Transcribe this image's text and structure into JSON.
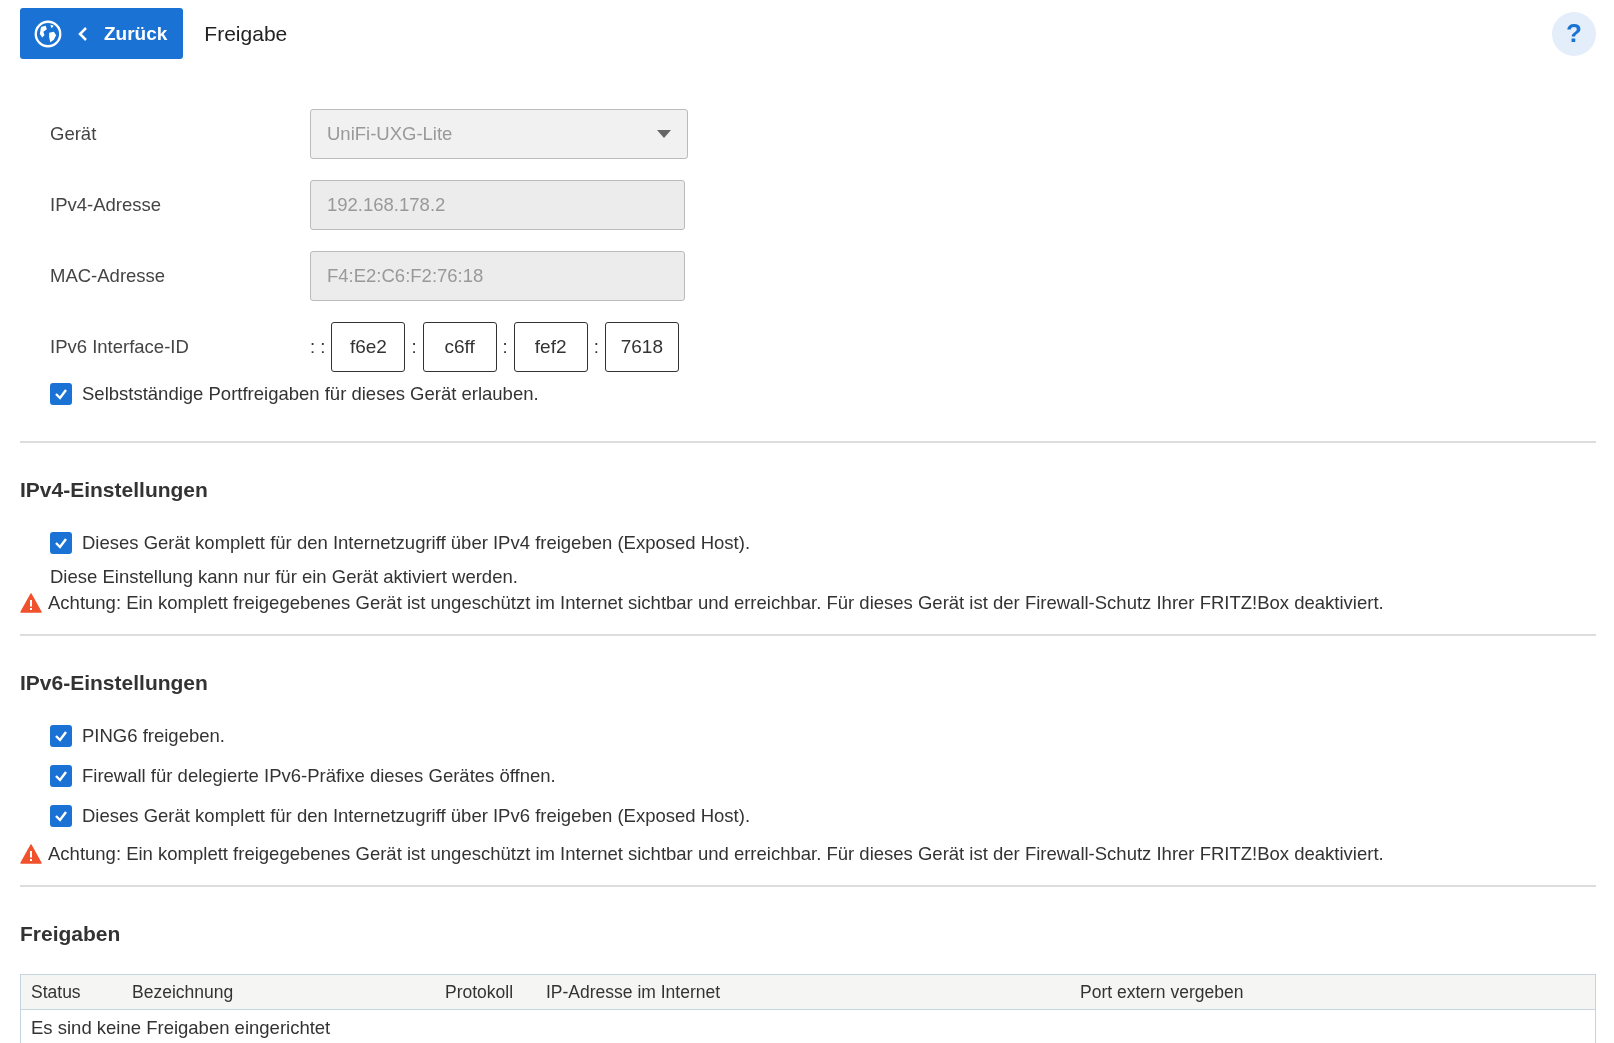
{
  "header": {
    "back_button": "Zurück",
    "title": "Freigabe",
    "help": "?"
  },
  "form": {
    "fields": [
      {
        "kind": "dropdown",
        "label": "Gerät",
        "value": "UniFi-UXG-Lite",
        "disabled": true
      },
      {
        "kind": "text",
        "label": "IPv4-Adresse",
        "value": "192.168.178.2",
        "disabled": true
      },
      {
        "kind": "text",
        "label": "MAC-Adresse",
        "value": "F4:E2:C6:F2:76:18",
        "disabled": true
      }
    ],
    "ipv6_interface_id": {
      "label": "IPv6 Interface-ID",
      "prefix": ": :",
      "separator": ":",
      "parts": [
        "f6e2",
        "c6ff",
        "fef2",
        "7618"
      ]
    },
    "checkbox": {
      "label": "Selbstständige Portfreigaben für dieses Gerät erlauben.",
      "checked": true
    }
  },
  "sections": [
    {
      "title": "IPv4-Einstellungen",
      "items": [
        {
          "kind": "checkbox",
          "text": "Dieses Gerät komplett für den Internetzugriff über IPv4 freigeben (Exposed Host).",
          "checked": true
        },
        {
          "kind": "note",
          "text": "Diese Einstellung kann nur für ein Gerät aktiviert werden."
        },
        {
          "kind": "warning",
          "text": "Achtung: Ein komplett freigegebenes Gerät ist ungeschützt im Internet sichtbar und erreichbar. Für dieses Gerät ist der Firewall-Schutz Ihrer FRITZ!Box deaktiviert."
        }
      ]
    },
    {
      "title": "IPv6-Einstellungen",
      "items": [
        {
          "kind": "checkbox",
          "text": "PING6 freigeben.",
          "checked": true
        },
        {
          "kind": "checkbox",
          "text": "Firewall für delegierte IPv6-Präfixe dieses Gerätes öffnen.",
          "checked": true
        },
        {
          "kind": "checkbox",
          "text": "Dieses Gerät komplett für den Internetzugriff über IPv6 freigeben (Exposed Host).",
          "checked": true
        },
        {
          "kind": "warning",
          "text": "Achtung: Ein komplett freigegebenes Gerät ist ungeschützt im Internet sichtbar und erreichbar. Für dieses Gerät ist der Firewall-Schutz Ihrer FRITZ!Box deaktiviert."
        }
      ]
    }
  ],
  "freigaben": {
    "title": "Freigaben",
    "table": {
      "columns": [
        "Status",
        "Bezeichnung",
        "Protokoll",
        "IP-Adresse im Internet",
        "Port extern vergeben"
      ],
      "empty_message": "Es sind keine Freigaben eingerichtet"
    }
  }
}
